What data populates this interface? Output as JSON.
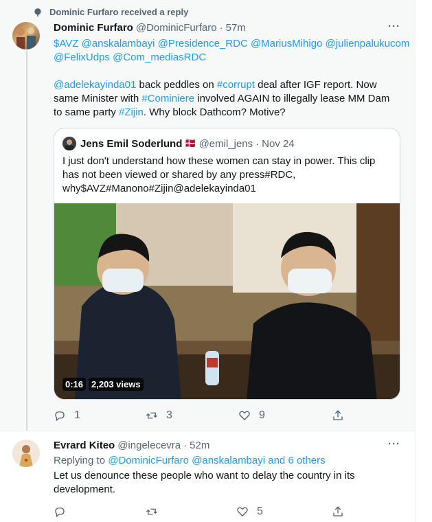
{
  "social_context": "Dominic Furfaro received a reply",
  "tweet1": {
    "name": "Dominic Furfaro",
    "handle": "@DominicFurfaro",
    "dot": "·",
    "time": "57m",
    "more": "···",
    "mentions_line1": "$AVZ @anskalambayi @Presidence_RDC @MariusMihigo @julienpalukucom",
    "mentions_line2": "@FelixUdps @Com_mediasRDC",
    "p_mention": "@adelekayinda01",
    "p_1": " back peddles on ",
    "p_tag_corrupt": "#corrupt",
    "p_2": " deal after IGF report. Now",
    "p_3": "same Minister with ",
    "p_tag_cominiere": "#Cominiere",
    "p_4": " involved AGAIN to illegally lease MM Dam",
    "p_5": "to same party ",
    "p_tag_zijin": "#Zijin",
    "p_6": ". Why block Dathcom? Motive?",
    "quote": {
      "name": "Jens Emil Soderlund",
      "flag": "🇩🇰",
      "handle": "@emil_jens",
      "dot": "·",
      "date": "Nov 24",
      "line1": "I just don't understand how these women can stay in power. This clip",
      "line2": "has not been viewed or shared by any press#RDC,",
      "line3": "why$AVZ#Manono#Zijin@adelekayinda01",
      "video_time": "0:16",
      "video_views": "2,203 views"
    },
    "actions": {
      "replies": "1",
      "retweets": "3",
      "likes": "9"
    }
  },
  "tweet2": {
    "name": "Evrard Kiteo",
    "handle": "@ingelecevra",
    "dot": "·",
    "time": "52m",
    "more": "···",
    "replying_prefix": "Replying to ",
    "replying_to": "@DominicFurfaro @anskalambayi and 6 others",
    "text_line1": "Let us denounce these people who want to delay the country in its",
    "text_line2": "development.",
    "actions": {
      "replies": "",
      "retweets": "",
      "likes": "5"
    }
  },
  "colors": {
    "link": "#1d9bf0",
    "muted": "#536471",
    "text": "#0f1419"
  }
}
